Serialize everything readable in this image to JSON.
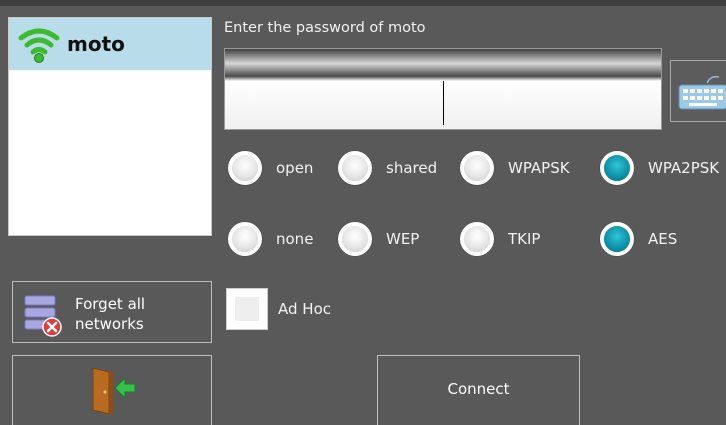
{
  "networks": {
    "items": [
      {
        "ssid": "moto",
        "icon": "wifi-signal-icon"
      }
    ]
  },
  "password": {
    "prompt": "Enter the password of moto",
    "value": "",
    "keyboard_icon": "keyboard-icon"
  },
  "auth": {
    "options": [
      {
        "label": "open",
        "selected": false
      },
      {
        "label": "shared",
        "selected": false
      },
      {
        "label": "WPAPSK",
        "selected": false
      },
      {
        "label": "WPA2PSK",
        "selected": true
      }
    ]
  },
  "encryption": {
    "options": [
      {
        "label": "none",
        "selected": false
      },
      {
        "label": "WEP",
        "selected": false
      },
      {
        "label": "TKIP",
        "selected": false
      },
      {
        "label": "AES",
        "selected": true
      }
    ]
  },
  "adhoc": {
    "label": "Ad Hoc",
    "checked": false
  },
  "buttons": {
    "forget_line1": "Forget all",
    "forget_line2": "networks",
    "forget_icon": "forget-networks-icon",
    "exit_icon": "exit-door-icon",
    "connect": "Connect"
  },
  "colors": {
    "background": "#595959",
    "list_selected": "#b9dcea",
    "radio_selected": "#0b8fa6",
    "wifi_green": "#3dbb2e"
  }
}
